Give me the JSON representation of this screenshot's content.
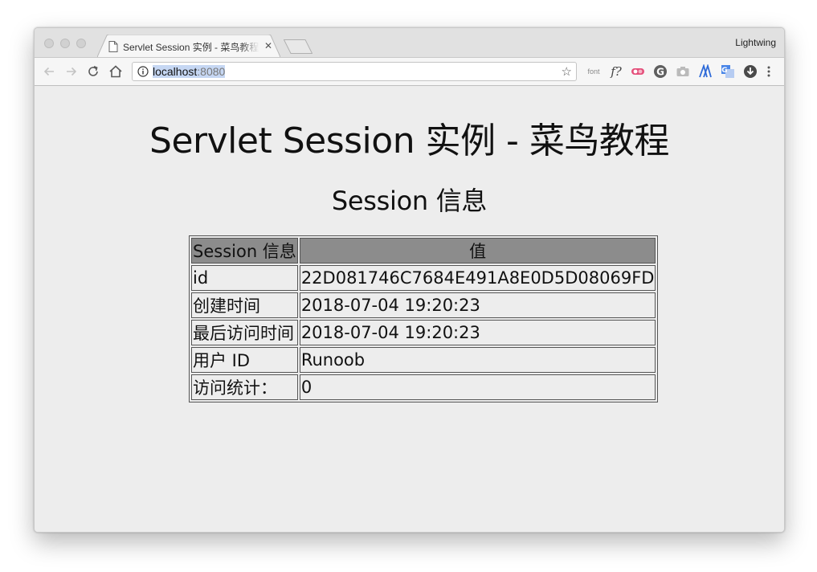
{
  "browser": {
    "tab": {
      "title": "Servlet Session 实例 - 菜鸟教程",
      "close": "✕"
    },
    "profile_name": "Lightwing",
    "address": {
      "host": "localhost",
      "port": ":8080"
    },
    "extensions": {
      "font_label": "font",
      "fquery_label": "f?"
    },
    "icons": {
      "back": "arrow-left",
      "forward": "arrow-right",
      "reload": "reload",
      "home": "home",
      "info": "info-circle",
      "bookmark": "star",
      "menu": "three-dots"
    }
  },
  "page": {
    "heading": "Servlet Session 实例 - 菜鸟教程",
    "subheading": "Session 信息",
    "table": {
      "headers": [
        "Session 信息",
        "值"
      ],
      "rows": [
        [
          "id",
          "22D081746C7684E491A8E0D5D08069FD"
        ],
        [
          "创建时间",
          "2018-07-04 19:20:23"
        ],
        [
          "最后访问时间",
          "2018-07-04 19:20:23"
        ],
        [
          "用户 ID",
          "Runoob"
        ],
        [
          "访问统计：",
          "0"
        ]
      ]
    }
  },
  "colors": {
    "table_header_bg": "#8c8c8c",
    "page_bg": "#ededed"
  }
}
